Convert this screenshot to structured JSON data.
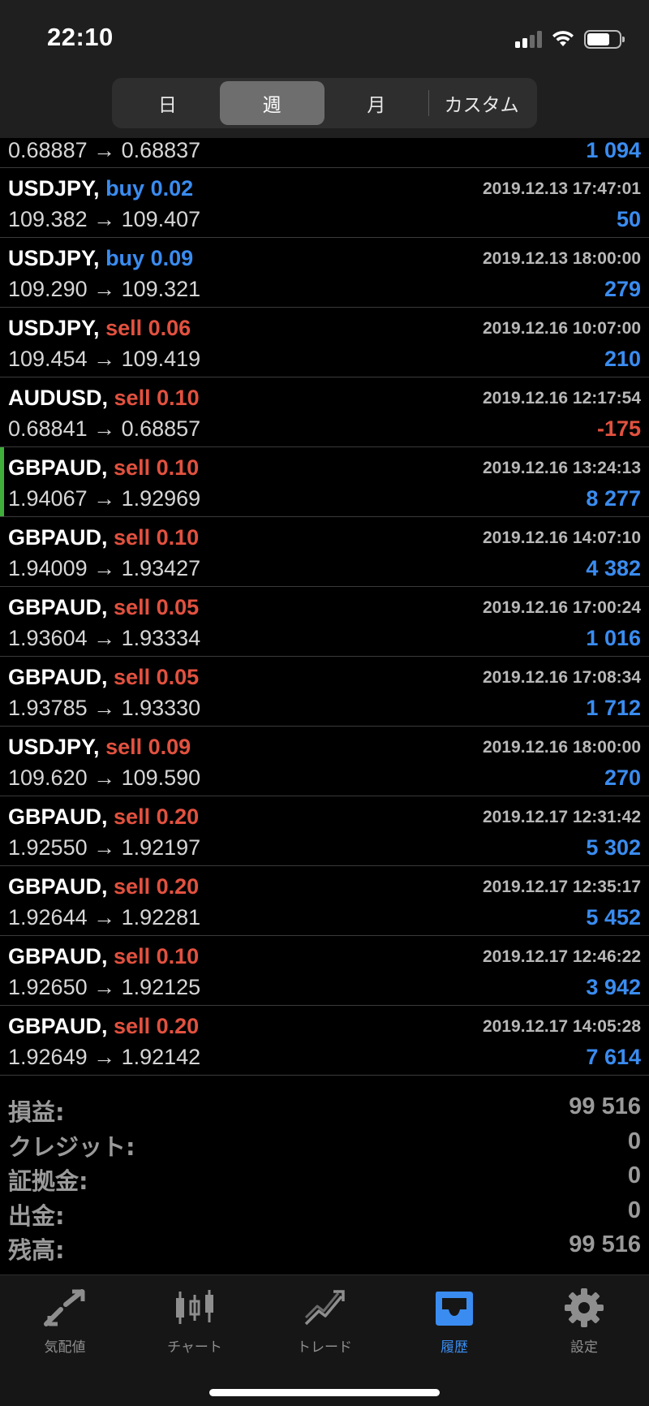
{
  "status_bar": {
    "time": "22:10"
  },
  "period_tabs": [
    {
      "label": "日",
      "active": false
    },
    {
      "label": "週",
      "active": true
    },
    {
      "label": "月",
      "active": false
    },
    {
      "label": "カスタム",
      "active": false
    }
  ],
  "first_row_partial": {
    "prices": "0.68887 → 0.68837",
    "profit": "1 094"
  },
  "trades": [
    {
      "symbol": "USDJPY",
      "side": "buy",
      "volume": "0.02",
      "datetime": "2019.12.13 17:47:01",
      "prices": "109.382 → 109.407",
      "profit": "50",
      "marked": false
    },
    {
      "symbol": "USDJPY",
      "side": "buy",
      "volume": "0.09",
      "datetime": "2019.12.13 18:00:00",
      "prices": "109.290 → 109.321",
      "profit": "279",
      "marked": false
    },
    {
      "symbol": "USDJPY",
      "side": "sell",
      "volume": "0.06",
      "datetime": "2019.12.16 10:07:00",
      "prices": "109.454 → 109.419",
      "profit": "210",
      "marked": false
    },
    {
      "symbol": "AUDUSD",
      "side": "sell",
      "volume": "0.10",
      "datetime": "2019.12.16 12:17:54",
      "prices": "0.68841 → 0.68857",
      "profit": "-175",
      "marked": false
    },
    {
      "symbol": "GBPAUD",
      "side": "sell",
      "volume": "0.10",
      "datetime": "2019.12.16 13:24:13",
      "prices": "1.94067 → 1.92969",
      "profit": "8 277",
      "marked": true
    },
    {
      "symbol": "GBPAUD",
      "side": "sell",
      "volume": "0.10",
      "datetime": "2019.12.16 14:07:10",
      "prices": "1.94009 → 1.93427",
      "profit": "4 382",
      "marked": false
    },
    {
      "symbol": "GBPAUD",
      "side": "sell",
      "volume": "0.05",
      "datetime": "2019.12.16 17:00:24",
      "prices": "1.93604 → 1.93334",
      "profit": "1 016",
      "marked": false
    },
    {
      "symbol": "GBPAUD",
      "side": "sell",
      "volume": "0.05",
      "datetime": "2019.12.16 17:08:34",
      "prices": "1.93785 → 1.93330",
      "profit": "1 712",
      "marked": false
    },
    {
      "symbol": "USDJPY",
      "side": "sell",
      "volume": "0.09",
      "datetime": "2019.12.16 18:00:00",
      "prices": "109.620 → 109.590",
      "profit": "270",
      "marked": false
    },
    {
      "symbol": "GBPAUD",
      "side": "sell",
      "volume": "0.20",
      "datetime": "2019.12.17 12:31:42",
      "prices": "1.92550 → 1.92197",
      "profit": "5 302",
      "marked": false
    },
    {
      "symbol": "GBPAUD",
      "side": "sell",
      "volume": "0.20",
      "datetime": "2019.12.17 12:35:17",
      "prices": "1.92644 → 1.92281",
      "profit": "5 452",
      "marked": false
    },
    {
      "symbol": "GBPAUD",
      "side": "sell",
      "volume": "0.10",
      "datetime": "2019.12.17 12:46:22",
      "prices": "1.92650 → 1.92125",
      "profit": "3 942",
      "marked": false
    },
    {
      "symbol": "GBPAUD",
      "side": "sell",
      "volume": "0.20",
      "datetime": "2019.12.17 14:05:28",
      "prices": "1.92649 → 1.92142",
      "profit": "7 614",
      "marked": false
    }
  ],
  "summary": [
    {
      "label": "損益:",
      "value": "99 516"
    },
    {
      "label": "クレジット:",
      "value": "0"
    },
    {
      "label": "証拠金:",
      "value": "0"
    },
    {
      "label": "出金:",
      "value": "0"
    },
    {
      "label": "残高:",
      "value": "99 516"
    }
  ],
  "tab_bar": [
    {
      "label": "気配値",
      "icon": "quotes-icon",
      "active": false
    },
    {
      "label": "チャート",
      "icon": "chart-icon",
      "active": false
    },
    {
      "label": "トレード",
      "icon": "trade-icon",
      "active": false
    },
    {
      "label": "履歴",
      "icon": "history-inbox-icon",
      "active": true
    },
    {
      "label": "設定",
      "icon": "settings-gear-icon",
      "active": false
    }
  ],
  "colors": {
    "buy": "#3a8cf0",
    "sell": "#e2513f",
    "profit_positive": "#3a8cf0",
    "profit_negative": "#e2513f",
    "marker": "#3fae3b",
    "active_tab": "#3a8cf0"
  }
}
